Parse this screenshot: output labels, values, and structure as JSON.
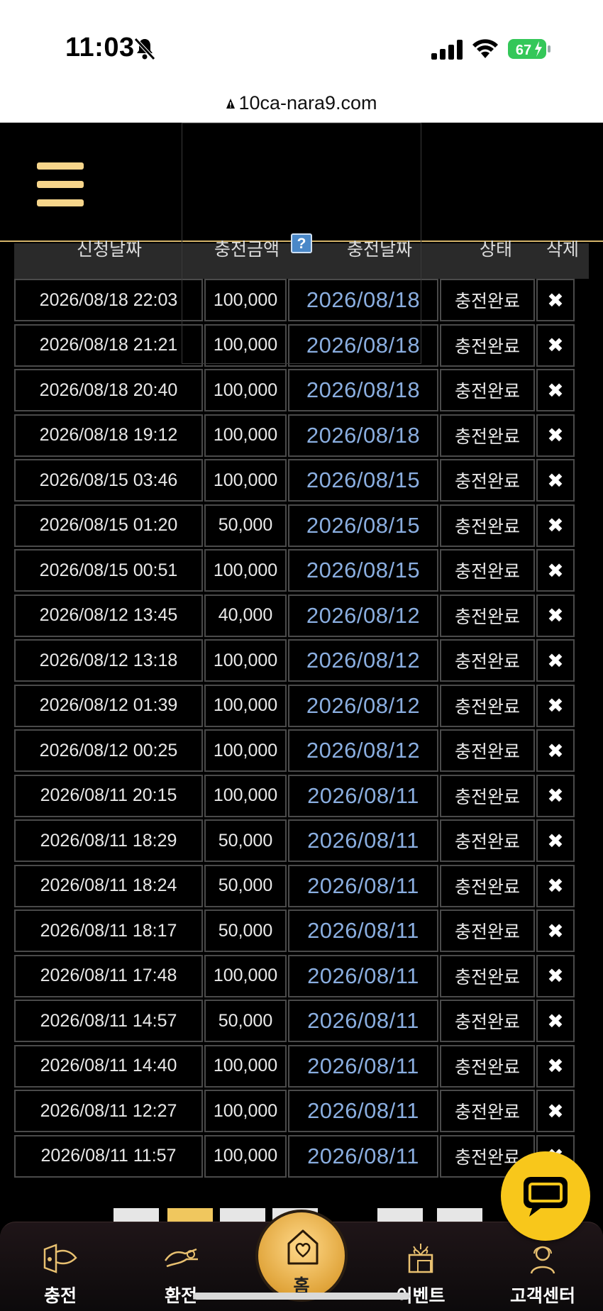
{
  "status_bar": {
    "time": "11:03",
    "battery": "67"
  },
  "browser": {
    "url": "10ca-nara9.com"
  },
  "table": {
    "headers": [
      "신청날짜",
      "충전금액",
      "충전날짜",
      "상태",
      "삭제"
    ],
    "help_mark": "?",
    "delete_mark": "✖",
    "rows": [
      [
        "2026/08/18 22:03",
        "100,000",
        "2026/08/18",
        "충전완료"
      ],
      [
        "2026/08/18 21:21",
        "100,000",
        "2026/08/18",
        "충전완료"
      ],
      [
        "2026/08/18 20:40",
        "100,000",
        "2026/08/18",
        "충전완료"
      ],
      [
        "2026/08/18 19:12",
        "100,000",
        "2026/08/18",
        "충전완료"
      ],
      [
        "2026/08/15 03:46",
        "100,000",
        "2026/08/15",
        "충전완료"
      ],
      [
        "2026/08/15 01:20",
        "50,000",
        "2026/08/15",
        "충전완료"
      ],
      [
        "2026/08/15 00:51",
        "100,000",
        "2026/08/15",
        "충전완료"
      ],
      [
        "2026/08/12 13:45",
        "40,000",
        "2026/08/12",
        "충전완료"
      ],
      [
        "2026/08/12 13:18",
        "100,000",
        "2026/08/12",
        "충전완료"
      ],
      [
        "2026/08/12 01:39",
        "100,000",
        "2026/08/12",
        "충전완료"
      ],
      [
        "2026/08/12 00:25",
        "100,000",
        "2026/08/12",
        "충전완료"
      ],
      [
        "2026/08/11 20:15",
        "100,000",
        "2026/08/11",
        "충전완료"
      ],
      [
        "2026/08/11 18:29",
        "50,000",
        "2026/08/11",
        "충전완료"
      ],
      [
        "2026/08/11 18:24",
        "50,000",
        "2026/08/11",
        "충전완료"
      ],
      [
        "2026/08/11 18:17",
        "50,000",
        "2026/08/11",
        "충전완료"
      ],
      [
        "2026/08/11 17:48",
        "100,000",
        "2026/08/11",
        "충전완료"
      ],
      [
        "2026/08/11 14:57",
        "50,000",
        "2026/08/11",
        "충전완료"
      ],
      [
        "2026/08/11 14:40",
        "100,000",
        "2026/08/11",
        "충전완료"
      ],
      [
        "2026/08/11 12:27",
        "100,000",
        "2026/08/11",
        "충전완료"
      ],
      [
        "2026/08/11 11:57",
        "100,000",
        "2026/08/11",
        "충전완료"
      ]
    ]
  },
  "bottom_nav": {
    "charge": "충전",
    "exchange": "환전",
    "home": "홈",
    "event": "이벤트",
    "support": "고객센터"
  },
  "colors": {
    "accent_gold": "#f6d58b",
    "date_blue": "#8aaee0",
    "chat_yellow": "#f8c71b",
    "battery_green": "#34c759"
  }
}
